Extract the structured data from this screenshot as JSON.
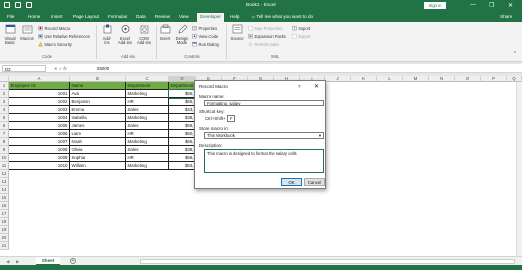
{
  "title_bar": {
    "title": "Book1 - Excel",
    "sign_in": "Sign in",
    "window_controls": [
      "—",
      "❐",
      "✕"
    ]
  },
  "tabs": [
    "File",
    "Home",
    "Insert",
    "Page Layout",
    "Formulas",
    "Data",
    "Review",
    "View",
    "Developer",
    "Help"
  ],
  "tell_me": "Tell me what you want to do",
  "share": "Share",
  "ribbon": {
    "code": {
      "visual_basic_line1": "Visual",
      "visual_basic_line2": "Basic",
      "macros": "Macros",
      "record_macro": "Record Macro",
      "relative_refs": "Use Relative References",
      "macro_security": "Macro Security",
      "group_label": "Code"
    },
    "addins": {
      "addins_line1": "Add-",
      "addins_line2": "ins",
      "excel_addins_line1": "Excel",
      "excel_addins_line2": "Add-ins",
      "com_addins_line1": "COM",
      "com_addins_line2": "Add-ins",
      "group_label": "Add-ins"
    },
    "controls": {
      "insert": "Insert",
      "design_mode_line1": "Design",
      "design_mode_line2": "Mode",
      "properties": "Properties",
      "view_code": "View Code",
      "run_dialog": "Run Dialog",
      "group_label": "Controls"
    },
    "xml": {
      "source": "Source",
      "map_properties": "Map Properties",
      "expansion_packs": "Expansion Packs",
      "refresh_data": "Refresh Data",
      "import": "Import",
      "export": "Export",
      "group_label": "XML"
    }
  },
  "formula_bar": {
    "name_box": "D2",
    "formula_value": "55000"
  },
  "columns": [
    "A",
    "B",
    "C",
    "D",
    "E",
    "F",
    "G",
    "H",
    "I",
    "J",
    "K",
    "L",
    "M",
    "N",
    "O",
    "P",
    "Q"
  ],
  "rows": [
    "1",
    "2",
    "3",
    "4",
    "5",
    "6",
    "7",
    "8",
    "9",
    "10",
    "11",
    "12",
    "13",
    "14",
    "15",
    "16",
    "17",
    "18",
    "19",
    "20",
    "21"
  ],
  "table": {
    "headers": [
      "Employee ID",
      "Name",
      "Department",
      "Department"
    ],
    "rows": [
      [
        "1001",
        "Ava",
        "Marketing",
        "$55,"
      ],
      [
        "1002",
        "Benjamin",
        "HR",
        "$65,"
      ],
      [
        "1003",
        "Emma",
        "Sales",
        "$43,"
      ],
      [
        "1004",
        "Isabella",
        "Marketing",
        "$38,"
      ],
      [
        "1005",
        "James",
        "Sales",
        "$59,"
      ],
      [
        "1006",
        "Liam",
        "HR",
        "$60,"
      ],
      [
        "1007",
        "Noah",
        "Marketing",
        "$65,"
      ],
      [
        "1008",
        "Olivia",
        "Sales",
        "$39,"
      ],
      [
        "1009",
        "Sophia",
        "HR",
        "$56,"
      ],
      [
        "1010",
        "William",
        "Marketing",
        "$53,"
      ]
    ]
  },
  "dialog": {
    "title": "Record Macro",
    "help": "?",
    "close": "✕",
    "macro_name_label": "Macro name:",
    "macro_name_value": "Formatting_salary",
    "shortcut_label": "Shortcut key:",
    "shortcut_prefix": "Ctrl+Shift+",
    "shortcut_value": "F",
    "store_label": "Store macro in:",
    "store_value": "This Workbook",
    "description_label": "Description:",
    "description_value": "This macro is designed to format the salary cells",
    "ok": "OK",
    "cancel": "Cancel"
  },
  "sheet_tabs": [
    "Sheet"
  ],
  "colors": {
    "brand": "#217346",
    "header_fill": "#70ad47"
  }
}
